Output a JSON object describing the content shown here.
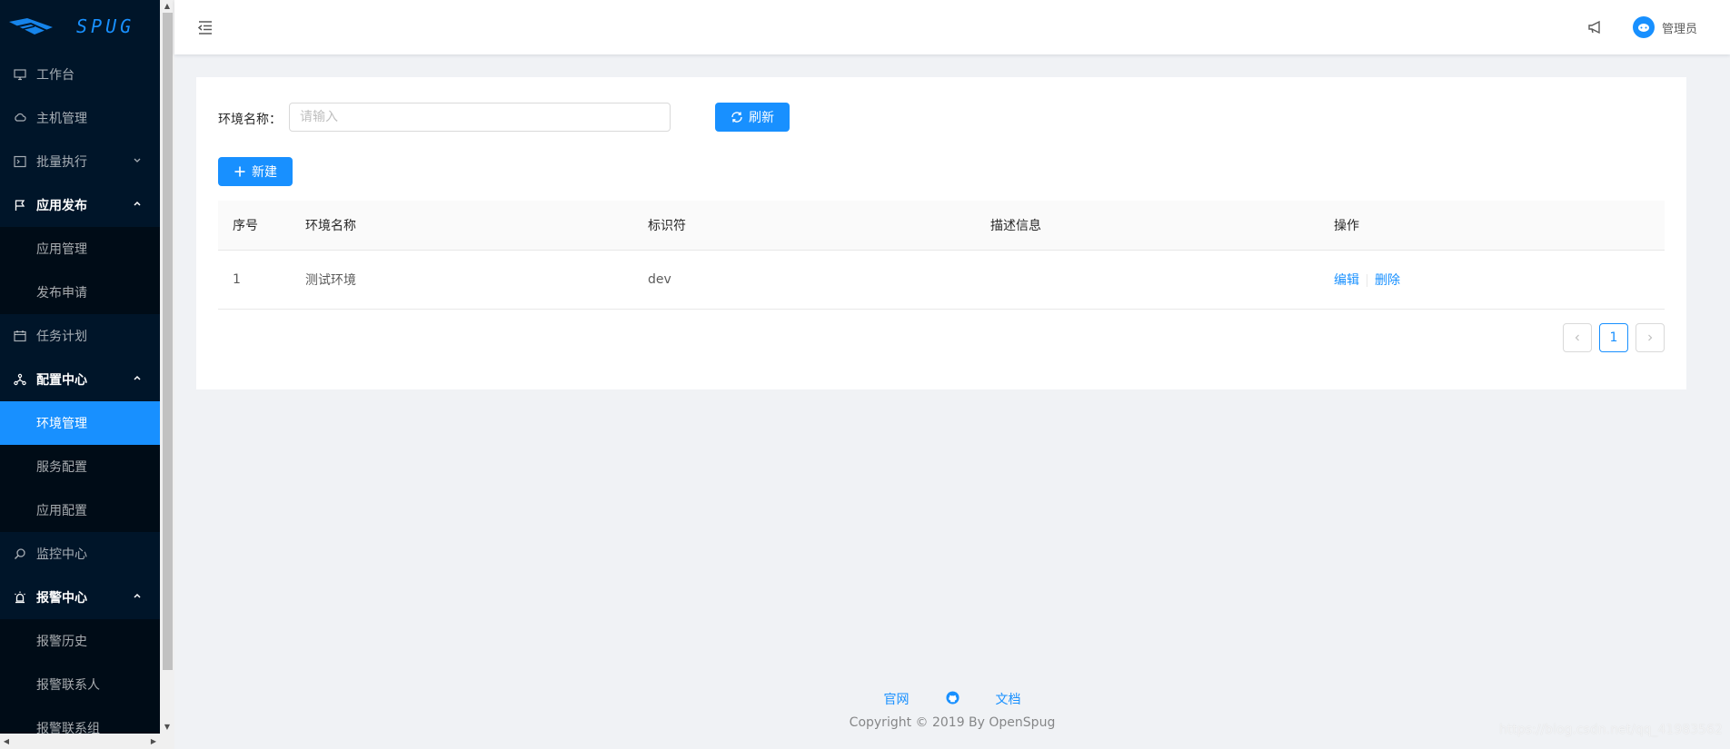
{
  "app": {
    "logo_text": "SPUG",
    "brand_color": "#1890ff",
    "sidebar_bg": "#001529"
  },
  "sidebar": {
    "items": [
      {
        "label": "工作台",
        "icon": "desktop-icon"
      },
      {
        "label": "主机管理",
        "icon": "cloud-server-icon"
      },
      {
        "label": "批量执行",
        "icon": "code-icon",
        "expanded": false
      },
      {
        "label": "应用发布",
        "icon": "flag-icon",
        "expanded": true,
        "children": [
          {
            "label": "应用管理"
          },
          {
            "label": "发布申请"
          }
        ]
      },
      {
        "label": "任务计划",
        "icon": "schedule-icon"
      },
      {
        "label": "配置中心",
        "icon": "deployment-unit-icon",
        "expanded": true,
        "children": [
          {
            "label": "环境管理",
            "selected": true
          },
          {
            "label": "服务配置"
          },
          {
            "label": "应用配置"
          }
        ]
      },
      {
        "label": "监控中心",
        "icon": "monitor-search-icon"
      },
      {
        "label": "报警中心",
        "icon": "alert-icon",
        "expanded": true,
        "children": [
          {
            "label": "报警历史"
          },
          {
            "label": "报警联系人"
          },
          {
            "label": "报警联系组"
          }
        ]
      }
    ]
  },
  "header": {
    "user_name": "管理员"
  },
  "filter": {
    "label": "环境名称：",
    "placeholder": "请输入",
    "refresh_label": "刷新"
  },
  "toolbar": {
    "new_label": "新建"
  },
  "table": {
    "columns": [
      "序号",
      "环境名称",
      "标识符",
      "描述信息",
      "操作"
    ],
    "rows": [
      {
        "index": "1",
        "name": "测试环境",
        "key": "dev",
        "desc": "",
        "actions": [
          "编辑",
          "删除"
        ]
      }
    ]
  },
  "pagination": {
    "current": "1",
    "prev": "<",
    "next": ">"
  },
  "footer": {
    "links": [
      "官网",
      "github-icon",
      "文档"
    ],
    "website_label": "官网",
    "docs_label": "文档",
    "copyright": "Copyright © 2019 By OpenSpug"
  },
  "watermark": "https://blog.csdn.net/qq_41983562"
}
